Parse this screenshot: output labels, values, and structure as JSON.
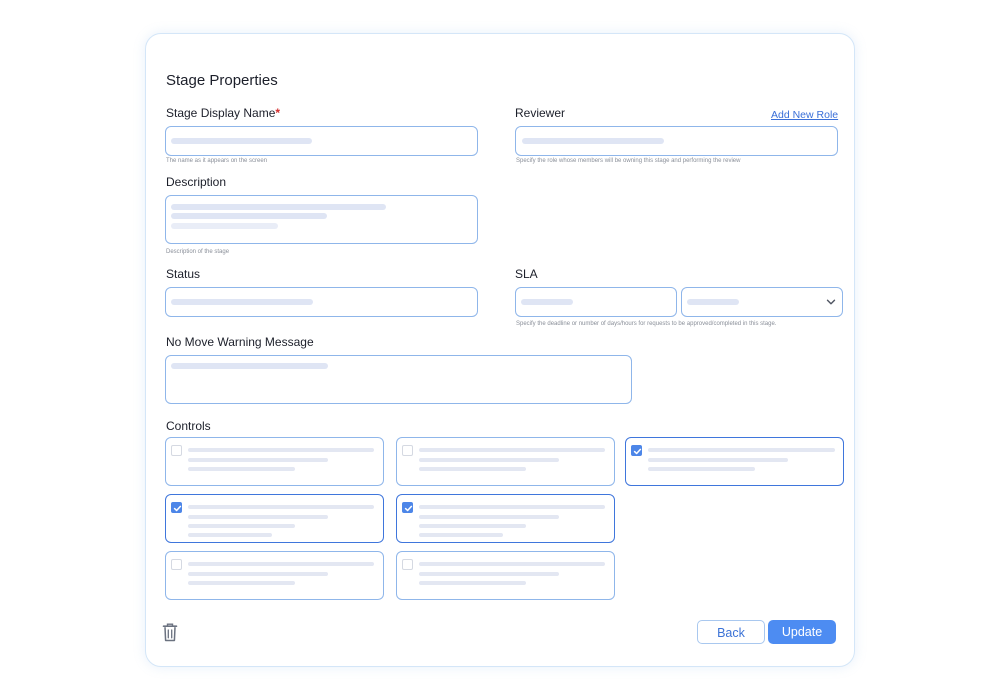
{
  "form": {
    "title": "Stage Properties",
    "display_name": {
      "label": "Stage Display Name",
      "required_mark": "*",
      "hint": "The name as it appears on the screen"
    },
    "reviewer": {
      "label": "Reviewer",
      "link": "Add New Role",
      "hint": "Specify the role whose members will be owning this stage and performing the review"
    },
    "description": {
      "label": "Description",
      "hint": "Description of the stage"
    },
    "status": {
      "label": "Status"
    },
    "sla": {
      "label": "SLA",
      "hint": "Specify the deadline or number of days/hours for requests to be approved/completed in this stage."
    },
    "no_move": {
      "label": "No Move Warning Message"
    },
    "controls": {
      "label": "Controls",
      "items": [
        {
          "checked": false
        },
        {
          "checked": false
        },
        {
          "checked": true
        },
        {
          "checked": true
        },
        {
          "checked": true
        },
        {
          "checked": false
        },
        {
          "checked": false
        }
      ]
    }
  },
  "footer": {
    "back_label": "Back",
    "update_label": "Update",
    "delete_icon": "trash-icon"
  },
  "colors": {
    "accent": "#4d8cf2",
    "field_border": "#8fb6ea",
    "required": "#d32f2f"
  }
}
